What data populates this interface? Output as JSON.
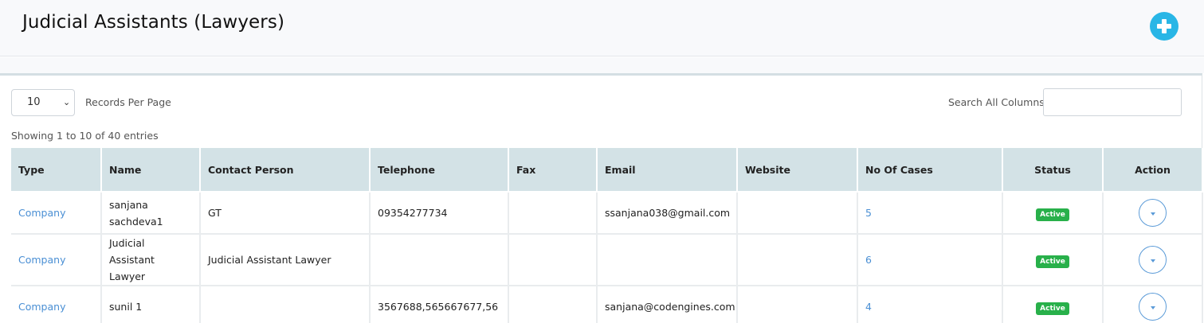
{
  "header": {
    "title": "Judicial Assistants (Lawyers)",
    "add_icon": "plus-circle-icon",
    "accent": "#29b6e6"
  },
  "controls": {
    "per_page_value": "10",
    "per_page_label": "Records Per Page",
    "search_label": "Search All Columns:",
    "search_value": "",
    "showing": "Showing 1 to 10 of 40 entries"
  },
  "table": {
    "headers": [
      "Type",
      "Name",
      "Contact Person",
      "Telephone",
      "Fax",
      "Email",
      "Website",
      "No Of Cases",
      "Status",
      "Action"
    ],
    "rows": [
      {
        "type": "Company",
        "name": "sanjana sachdeva1",
        "contact": "GT",
        "telephone": "09354277734",
        "fax": "",
        "email": "ssanjana038@gmail.com",
        "website": "",
        "cases": "5",
        "status": "Active"
      },
      {
        "type": "Company",
        "name": "Judicial Assistant Lawyer",
        "contact": "Judicial Assistant Lawyer",
        "telephone": "",
        "fax": "",
        "email": "",
        "website": "",
        "cases": "6",
        "status": "Active"
      },
      {
        "type": "Company",
        "name": "sunil 1",
        "contact": "",
        "telephone": "3567688,565667677,56",
        "fax": "",
        "email": "sanjana@codengines.com",
        "website": "",
        "cases": "4",
        "status": "Active"
      }
    ],
    "link_color": "#4a8fd4",
    "status_color": "#28b04a",
    "action_icon": "caret-down-icon"
  }
}
